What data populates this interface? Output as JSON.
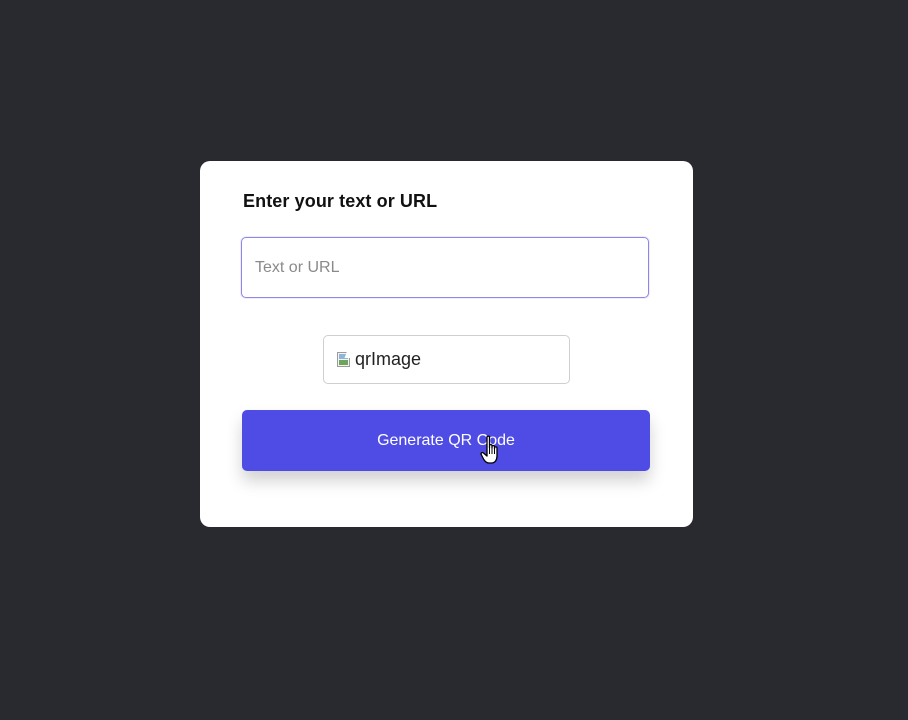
{
  "card": {
    "title": "Enter your text or URL",
    "input": {
      "value": "",
      "placeholder": "Text or URL"
    },
    "qr_image": {
      "alt_text": "qrImage",
      "icon": "broken-image-icon"
    },
    "generate_button": {
      "label": "Generate QR Code"
    }
  },
  "cursor": {
    "icon": "hand-pointer-icon"
  },
  "colors": {
    "background": "#282a30",
    "card": "#ffffff",
    "accent": "#4f4ce6",
    "input_focus_border": "#8f86e8"
  }
}
